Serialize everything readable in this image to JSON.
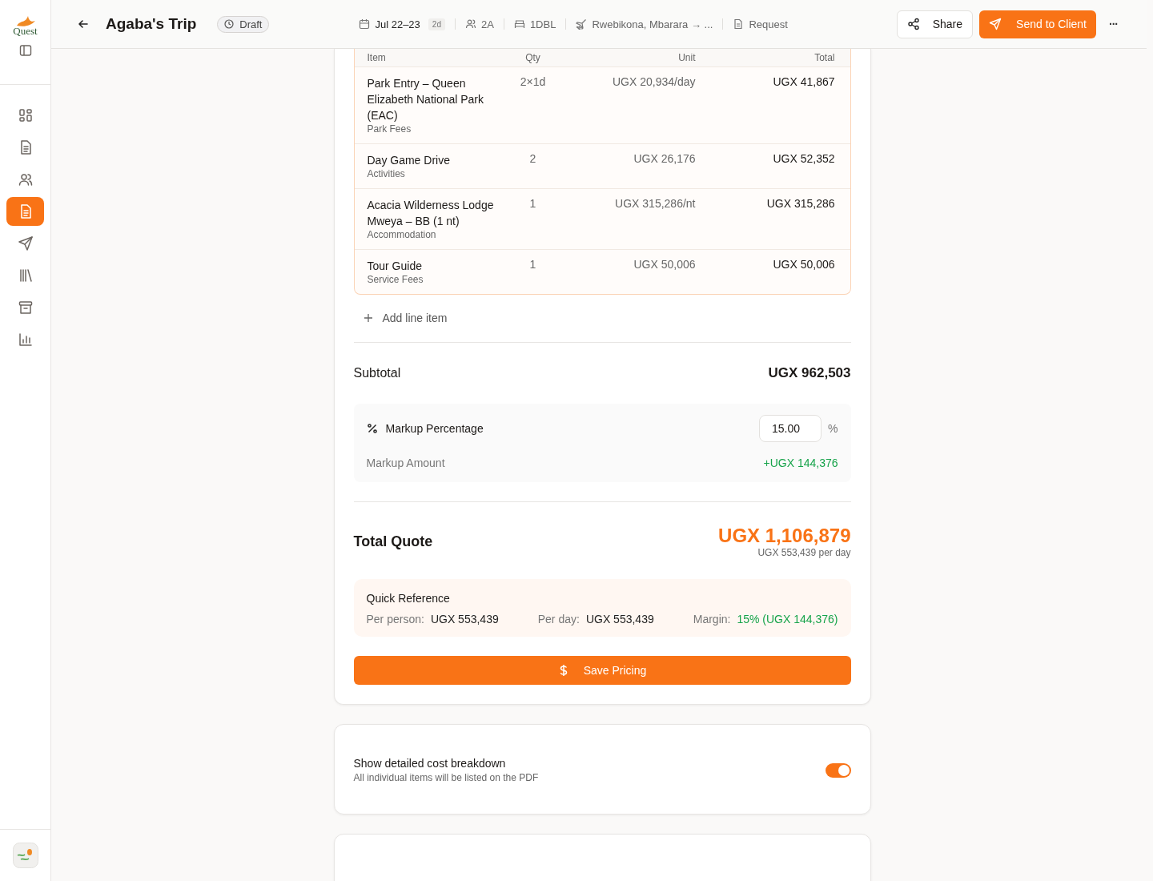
{
  "sidebar": {
    "logo": "Quest",
    "items": [
      {
        "selected": false
      },
      {
        "selected": false
      },
      {
        "selected": false
      },
      {
        "selected": true
      },
      {
        "selected": false
      },
      {
        "selected": false
      },
      {
        "selected": false
      },
      {
        "selected": false
      }
    ]
  },
  "header": {
    "title": "Agaba's Trip",
    "status": "Draft",
    "dates": "Jul 22–23",
    "duration": "2d",
    "travellers": "2A",
    "rooms": "1DBL",
    "route": "Rwebikona, Mbarara → ...",
    "request": "Request",
    "share": "Share",
    "send": "Send to Client",
    "more": "···"
  },
  "table": {
    "columns": [
      "Item",
      "Qty",
      "Unit",
      "Total"
    ],
    "rows": [
      {
        "name": "Park Entry – Queen Elizabeth National Park (EAC)",
        "category": "Park Fees",
        "qty": "2×1d",
        "unit": "UGX 20,934/day",
        "total": "UGX 41,867"
      },
      {
        "name": "Day Game Drive",
        "category": "Activities",
        "qty": "2",
        "unit": "UGX 26,176",
        "total": "UGX 52,352"
      },
      {
        "name": "Acacia Wilderness Lodge Mweya – BB (1 nt)",
        "category": "Accommodation",
        "qty": "1",
        "unit": "UGX 315,286/nt",
        "total": "UGX 315,286"
      },
      {
        "name": "Tour Guide",
        "category": "Service Fees",
        "qty": "1",
        "unit": "UGX 50,006",
        "total": "UGX 50,006"
      }
    ]
  },
  "add_line": "Add line item",
  "subtotal": {
    "label": "Subtotal",
    "value": "UGX 962,503"
  },
  "markup": {
    "label": "Markup Percentage",
    "value": "15.00",
    "unit": "%",
    "amount_label": "Markup Amount",
    "amount": "+UGX 144,376"
  },
  "total": {
    "label": "Total Quote",
    "value": "UGX 1,106,879",
    "per_day": "UGX 553,439 per day"
  },
  "quick_reference": {
    "title": "Quick Reference",
    "items": [
      {
        "label": "Per person:",
        "value": "UGX 553,439",
        "kind": "plain"
      },
      {
        "label": "Per day:",
        "value": "UGX 553,439",
        "kind": "plain"
      },
      {
        "label": "Margin:",
        "value": "15% (UGX 144,376)",
        "kind": "positive"
      }
    ]
  },
  "save_button": "Save Pricing",
  "breakdown": {
    "title": "Show detailed cost breakdown",
    "subtitle": "All individual items will be listed on the PDF",
    "on": true
  }
}
